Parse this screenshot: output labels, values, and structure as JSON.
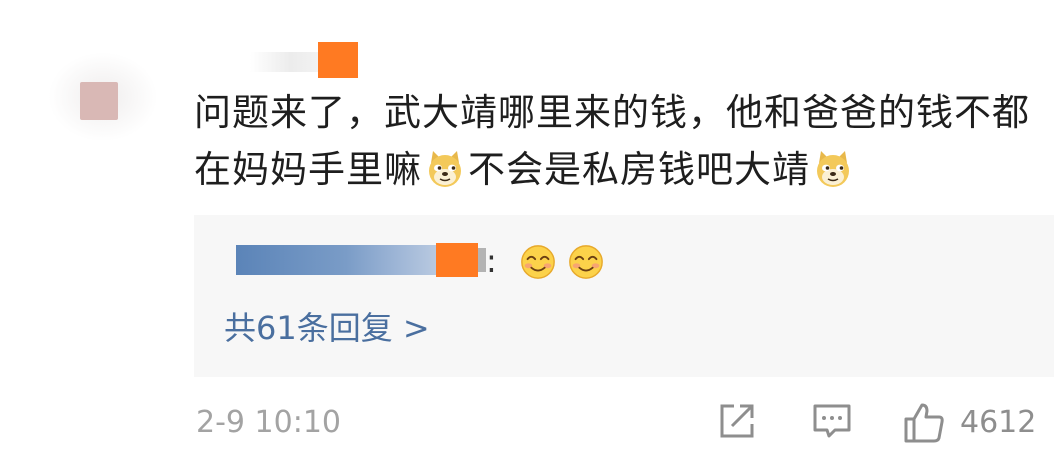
{
  "comment": {
    "text_part1": "问题来了，武大靖哪里来的钱，他和爸爸的钱不都在妈妈手里嘛",
    "text_part2": "不会是私房钱吧大靖",
    "emoji_name": "doge-icon"
  },
  "reply": {
    "colon": ":",
    "emoji_name": "smile-icon",
    "count_label": "共61条回复 >"
  },
  "footer": {
    "timestamp": "2-9 10:10",
    "like_count": "4612"
  },
  "colors": {
    "link": "#4a6f9f",
    "meta_gray": "#a3a3a3",
    "reply_bg": "#f7f7f7",
    "blur_orange": "#ff7a22",
    "blur_blue": "#5b84b8"
  }
}
